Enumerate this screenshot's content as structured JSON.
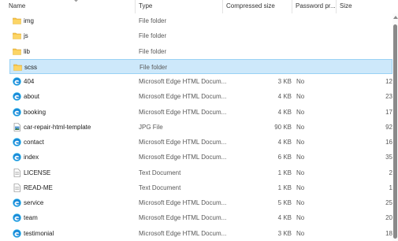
{
  "columns": {
    "name": "Name",
    "type": "Type",
    "compressed_size": "Compressed size",
    "password": "Password pr...",
    "size": "Size"
  },
  "files": [
    {
      "name": "img",
      "type": "File folder",
      "compressed": "",
      "password": "",
      "size": "",
      "icon": "folder-icon"
    },
    {
      "name": "js",
      "type": "File folder",
      "compressed": "",
      "password": "",
      "size": "",
      "icon": "folder-icon"
    },
    {
      "name": "lib",
      "type": "File folder",
      "compressed": "",
      "password": "",
      "size": "",
      "icon": "folder-icon"
    },
    {
      "name": "scss",
      "type": "File folder",
      "compressed": "",
      "password": "",
      "size": "",
      "icon": "folder-icon",
      "selected": true
    },
    {
      "name": "404",
      "type": "Microsoft Edge HTML Docum...",
      "compressed": "3 KB",
      "password": "No",
      "size": "12",
      "icon": "edge-icon"
    },
    {
      "name": "about",
      "type": "Microsoft Edge HTML Docum...",
      "compressed": "4 KB",
      "password": "No",
      "size": "23",
      "icon": "edge-icon"
    },
    {
      "name": "booking",
      "type": "Microsoft Edge HTML Docum...",
      "compressed": "4 KB",
      "password": "No",
      "size": "17",
      "icon": "edge-icon"
    },
    {
      "name": "car-repair-html-template",
      "type": "JPG File",
      "compressed": "90 KB",
      "password": "No",
      "size": "92",
      "icon": "image-file-icon"
    },
    {
      "name": "contact",
      "type": "Microsoft Edge HTML Docum...",
      "compressed": "4 KB",
      "password": "No",
      "size": "16",
      "icon": "edge-icon"
    },
    {
      "name": "index",
      "type": "Microsoft Edge HTML Docum...",
      "compressed": "6 KB",
      "password": "No",
      "size": "35",
      "icon": "edge-icon"
    },
    {
      "name": "LICENSE",
      "type": "Text Document",
      "compressed": "1 KB",
      "password": "No",
      "size": "2",
      "icon": "text-file-icon"
    },
    {
      "name": "READ-ME",
      "type": "Text Document",
      "compressed": "1 KB",
      "password": "No",
      "size": "1",
      "icon": "text-file-icon"
    },
    {
      "name": "service",
      "type": "Microsoft Edge HTML Docum...",
      "compressed": "5 KB",
      "password": "No",
      "size": "25",
      "icon": "edge-icon"
    },
    {
      "name": "team",
      "type": "Microsoft Edge HTML Docum...",
      "compressed": "4 KB",
      "password": "No",
      "size": "20",
      "icon": "edge-icon"
    },
    {
      "name": "testimonial",
      "type": "Microsoft Edge HTML Docum...",
      "compressed": "3 KB",
      "password": "No",
      "size": "18",
      "icon": "edge-icon"
    }
  ],
  "colors": {
    "selected_bg": "#cde8fa",
    "selected_border": "#99d1f5",
    "folder": "#f8c54b",
    "edge": "#1a8ad8"
  }
}
